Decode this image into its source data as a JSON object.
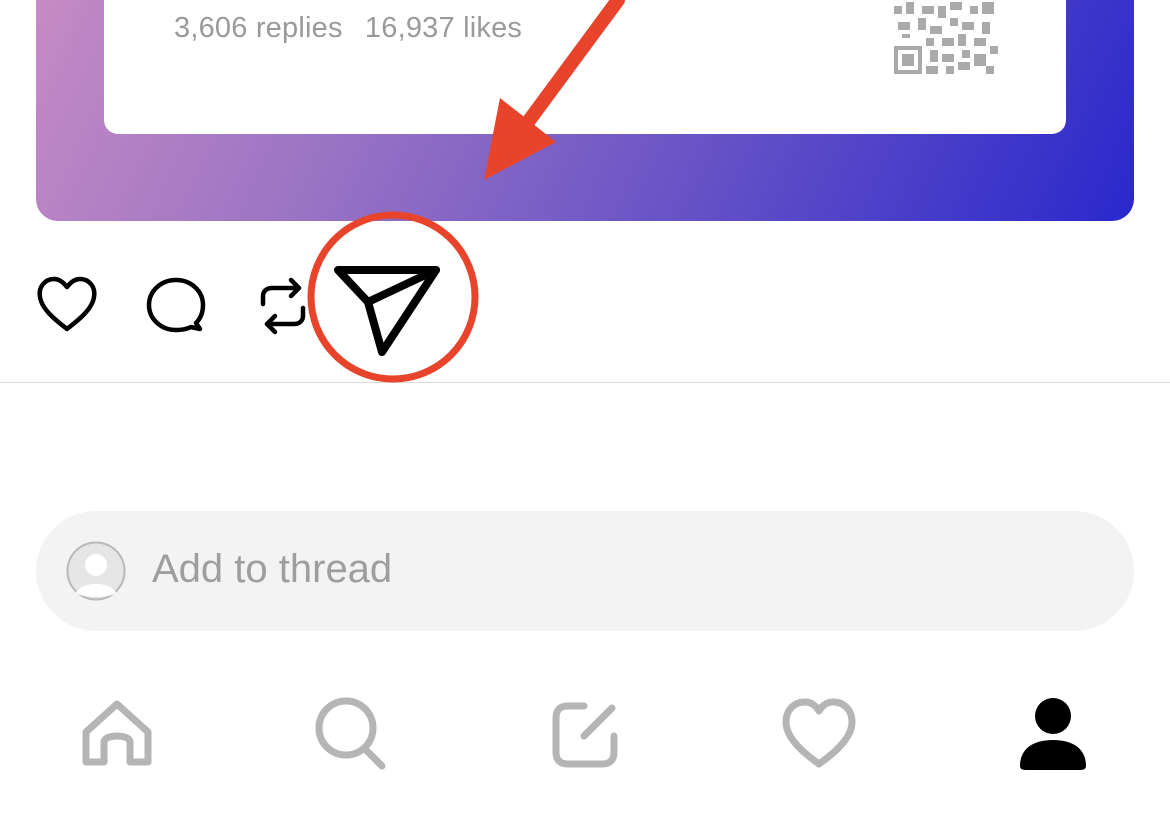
{
  "post": {
    "replies": "3,606 replies",
    "likes": "16,937 likes"
  },
  "actions": {
    "like_icon": "heart-icon",
    "reply_icon": "speech-bubble-icon",
    "repost_icon": "repost-icon",
    "share_icon": "paper-plane-icon"
  },
  "composer": {
    "placeholder": "Add to thread"
  },
  "tabbar": {
    "items": [
      {
        "icon": "home-icon",
        "active": false
      },
      {
        "icon": "search-icon",
        "active": false
      },
      {
        "icon": "compose-icon",
        "active": false
      },
      {
        "icon": "activity-heart-icon",
        "active": false
      },
      {
        "icon": "profile-icon",
        "active": true
      }
    ]
  },
  "colors": {
    "gradient_start": "#c68bc4",
    "gradient_end": "#2a28cc",
    "annotation_red": "#e8442b",
    "inactive_tab": "#b5b5b5",
    "active_tab": "#000000"
  }
}
